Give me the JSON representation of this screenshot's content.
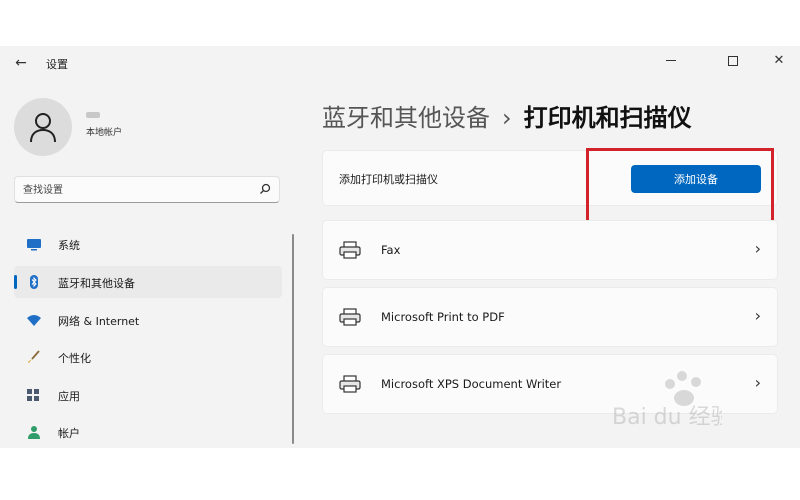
{
  "window": {
    "title": "设置",
    "back_icon": "arrow-left-icon",
    "controls": {
      "minimize": "minimize-icon",
      "maximize": "maximize-icon",
      "close_glyph": "✕"
    }
  },
  "profile": {
    "account_type": "本地帐户",
    "avatar_icon": "person-icon"
  },
  "search": {
    "placeholder": "查找设置",
    "icon": "search-icon"
  },
  "sidebar": {
    "items": [
      {
        "label": "系统",
        "icon": "monitor-icon",
        "active": false
      },
      {
        "label": "蓝牙和其他设备",
        "icon": "bluetooth-icon",
        "active": true
      },
      {
        "label": "网络 & Internet",
        "icon": "wifi-icon",
        "active": false
      },
      {
        "label": "个性化",
        "icon": "brush-icon",
        "active": false
      },
      {
        "label": "应用",
        "icon": "apps-icon",
        "active": false
      },
      {
        "label": "帐户",
        "icon": "account-icon",
        "active": false
      }
    ]
  },
  "breadcrumb": {
    "parent": "蓝牙和其他设备",
    "separator": "›",
    "current": "打印机和扫描仪"
  },
  "add_printer": {
    "label": "添加打印机或扫描仪",
    "button_label": "添加设备"
  },
  "printers": [
    {
      "name": "Fax",
      "icon": "printer-icon"
    },
    {
      "name": "Microsoft Print to PDF",
      "icon": "printer-icon"
    },
    {
      "name": "Microsoft XPS Document Writer",
      "icon": "printer-icon"
    }
  ],
  "colors": {
    "accent": "#0067c0",
    "highlight": "#d2232a",
    "background": "#f3f3f3",
    "card": "#fbfbfb"
  },
  "watermark": {
    "brand_text": "Bai du 经验"
  }
}
